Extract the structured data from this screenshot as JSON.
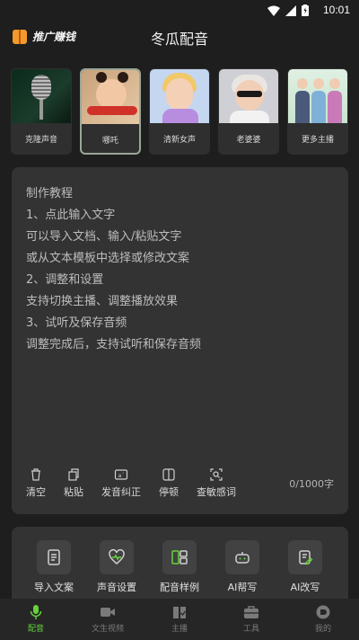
{
  "status": {
    "time": "10:01"
  },
  "header": {
    "promo_label": "推广赚钱",
    "title": "冬瓜配音"
  },
  "voices": [
    {
      "label": "克隆声音"
    },
    {
      "label": "哪吒"
    },
    {
      "label": "清新女声"
    },
    {
      "label": "老婆婆"
    },
    {
      "label": "更多主播"
    }
  ],
  "editor": {
    "tutorial": [
      "制作教程",
      "1、点此输入文字",
      "可以导入文档、输入/粘贴文字",
      "或从文本模板中选择或修改文案",
      "2、调整和设置",
      "支持切换主播、调整播放效果",
      "3、试听及保存音频",
      "调整完成后，支持试听和保存音频"
    ],
    "tools": {
      "clear": "清空",
      "paste": "粘贴",
      "pronounce": "发音纠正",
      "pause": "停顿",
      "sensitive": "查敏感词"
    },
    "char_count": "0/1000字"
  },
  "quick": {
    "import": "导入文案",
    "sound": "声音设置",
    "samples": "配音样例",
    "ai_help": "AI帮写",
    "ai_rewrite": "AI改写"
  },
  "nav": {
    "dub": "配音",
    "video": "文生视频",
    "host": "主播",
    "tools": "工具",
    "mine": "我的"
  },
  "colors": {
    "accent": "#66d23c",
    "background": "#1e1e1e",
    "panel": "#333333"
  }
}
